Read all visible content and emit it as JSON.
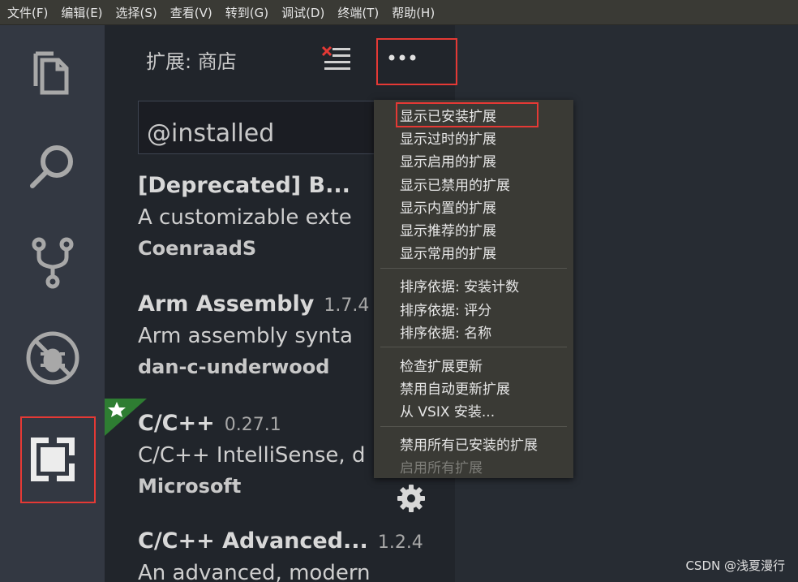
{
  "menubar": {
    "items": [
      "文件(F)",
      "编辑(E)",
      "选择(S)",
      "查看(V)",
      "转到(G)",
      "调试(D)",
      "终端(T)",
      "帮助(H)"
    ]
  },
  "activitybar": {
    "icons": [
      "files-icon",
      "search-icon",
      "source-control-icon",
      "debug-icon",
      "extensions-icon"
    ],
    "active": "extensions-icon"
  },
  "sidebar": {
    "title": "扩展: 商店",
    "search_value": "@installed"
  },
  "extensions": [
    {
      "name": "[Deprecated] B...",
      "version": "",
      "description": "A customizable exte",
      "publisher": "CoenraadS"
    },
    {
      "name": "Arm Assembly",
      "version": "1.7.4",
      "description": "Arm assembly synta",
      "publisher": "dan-c-underwood"
    },
    {
      "name": "C/C++",
      "version": "0.27.1",
      "description": "C/C++ IntelliSense, d",
      "publisher": "Microsoft",
      "recommended": true
    },
    {
      "name": "C/C++ Advanced...",
      "version": "1.2.4",
      "description": "An advanced, modern",
      "publisher": ""
    }
  ],
  "dropdown": {
    "items": [
      {
        "label": "显示已安装扩展",
        "enabled": true,
        "highlighted": true
      },
      {
        "label": "显示过时的扩展",
        "enabled": true
      },
      {
        "label": "显示启用的扩展",
        "enabled": true
      },
      {
        "label": "显示已禁用的扩展",
        "enabled": true
      },
      {
        "label": "显示内置的扩展",
        "enabled": true
      },
      {
        "label": "显示推荐的扩展",
        "enabled": true
      },
      {
        "label": "显示常用的扩展",
        "enabled": true
      },
      {
        "label": "排序依据: 安装计数",
        "enabled": true
      },
      {
        "label": "排序依据: 评分",
        "enabled": true
      },
      {
        "label": "排序依据: 名称",
        "enabled": true
      },
      {
        "label": "检查扩展更新",
        "enabled": true
      },
      {
        "label": "禁用自动更新扩展",
        "enabled": true
      },
      {
        "label": "从 VSIX 安装...",
        "enabled": true
      },
      {
        "label": "禁用所有已安装的扩展",
        "enabled": true
      },
      {
        "label": "启用所有扩展",
        "enabled": false
      }
    ]
  },
  "watermark": "CSDN @浅夏漫行",
  "colors": {
    "highlight": "#e53935",
    "star_badge": "#2e7d32"
  }
}
